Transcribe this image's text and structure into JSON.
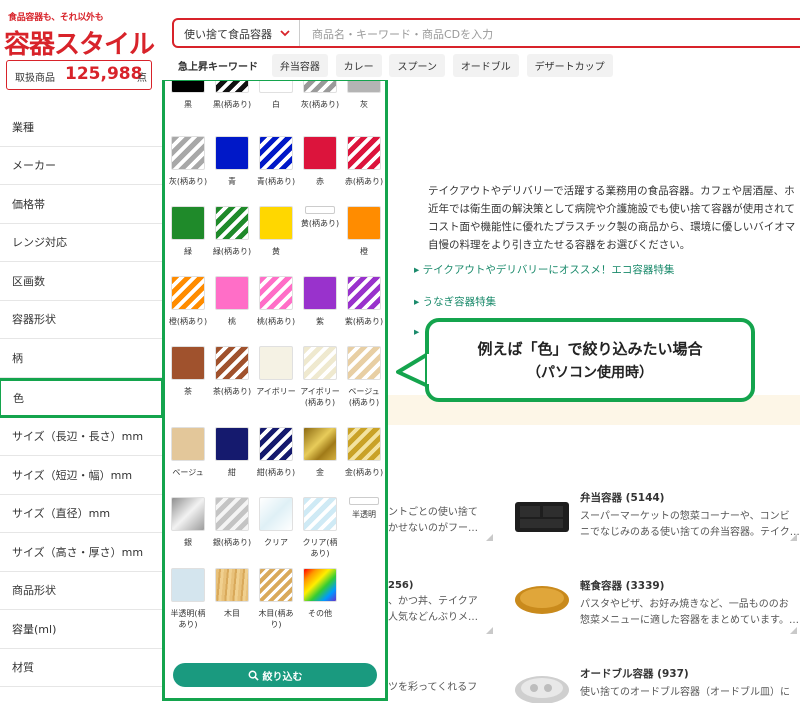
{
  "header": {
    "tagline": "食品容器も、それ以外も",
    "logo_text": "容器スタイル",
    "count_label": "取扱商品",
    "count_value": "125,988",
    "count_unit": "点",
    "search_select": "使い捨て食品容器",
    "search_placeholder": "商品名・キーワード・商品CDを入力",
    "hot_title": "急上昇キーワード",
    "hot_keywords": [
      "弁当容器",
      "カレー",
      "スプーン",
      "オードブル",
      "デザートカップ"
    ]
  },
  "left_nav": {
    "items": [
      {
        "label": "業種"
      },
      {
        "label": "メーカー"
      },
      {
        "label": "価格帯"
      },
      {
        "label": "レンジ対応"
      },
      {
        "label": "区画数"
      },
      {
        "label": "容器形状"
      },
      {
        "label": "柄"
      },
      {
        "label": "色"
      },
      {
        "label": "サイズ（長辺・長さ）mm"
      },
      {
        "label": "サイズ（短辺・幅）mm"
      },
      {
        "label": "サイズ（直径）mm"
      },
      {
        "label": "サイズ（高さ・厚さ）mm"
      },
      {
        "label": "商品形状"
      },
      {
        "label": "容量(ml)"
      },
      {
        "label": "材質"
      }
    ]
  },
  "color_panel": {
    "swatches": [
      {
        "label": "黒",
        "color": "#000000",
        "style": "solid"
      },
      {
        "label": "黒(柄あり)",
        "color": "#111111",
        "style": "stripe"
      },
      {
        "label": "白",
        "color": "#ffffff",
        "style": "solid"
      },
      {
        "label": "灰(柄あり)",
        "color": "#9a9a9a",
        "style": "stripe"
      },
      {
        "label": "灰",
        "color": "#b4b4b4",
        "style": "solid"
      },
      {
        "label": "灰(柄あり)",
        "color": "#a8a8a8",
        "style": "stripe"
      },
      {
        "label": "青",
        "color": "#0018c8",
        "style": "solid"
      },
      {
        "label": "青(柄あり)",
        "color": "#0018c8",
        "style": "stripe"
      },
      {
        "label": "赤",
        "color": "#dc143c",
        "style": "solid"
      },
      {
        "label": "赤(柄あり)",
        "color": "#dc143c",
        "style": "stripe"
      },
      {
        "label": "緑",
        "color": "#1f8a2a",
        "style": "solid"
      },
      {
        "label": "緑(柄あり)",
        "color": "#1f8a2a",
        "style": "stripe"
      },
      {
        "label": "黄",
        "color": "#ffd700",
        "style": "solid"
      },
      {
        "label": "黄(柄あり)",
        "color": "#ffffff",
        "style": "small"
      },
      {
        "label": "橙",
        "color": "#ff8c00",
        "style": "solid"
      },
      {
        "label": "橙(柄あり)",
        "color": "#ff8c00",
        "style": "stripe"
      },
      {
        "label": "桃",
        "color": "#ff6ec7",
        "style": "solid"
      },
      {
        "label": "桃(柄あり)",
        "color": "#ff6ec7",
        "style": "stripe"
      },
      {
        "label": "紫",
        "color": "#9932cc",
        "style": "solid"
      },
      {
        "label": "紫(柄あり)",
        "color": "#9932cc",
        "style": "stripe"
      },
      {
        "label": "茶",
        "color": "#a0522d",
        "style": "solid"
      },
      {
        "label": "茶(柄あり)",
        "color": "#a0522d",
        "style": "stripe"
      },
      {
        "label": "アイボリー",
        "color": "#f5f2e4",
        "style": "solid"
      },
      {
        "label": "アイボリー(柄あり)",
        "color": "#efe9cf",
        "style": "stripe"
      },
      {
        "label": "ベージュ(柄あり)",
        "color": "#e8cfa4",
        "style": "stripe"
      },
      {
        "label": "ベージュ",
        "color": "#e3c79a",
        "style": "solid"
      },
      {
        "label": "紺",
        "color": "#151a6e",
        "style": "solid"
      },
      {
        "label": "紺(柄あり)",
        "color": "#151a6e",
        "style": "stripe"
      },
      {
        "label": "金",
        "color": "#c9a227",
        "style": "gold"
      },
      {
        "label": "金(柄あり)",
        "color": "#c9a227",
        "style": "goldstripe"
      },
      {
        "label": "銀",
        "color": "#b8b8b8",
        "style": "silver"
      },
      {
        "label": "銀(柄あり)",
        "color": "#c4c4c4",
        "style": "silverstripe"
      },
      {
        "label": "クリア",
        "color": "#eaf4f8",
        "style": "clear"
      },
      {
        "label": "クリア(柄あり)",
        "color": "#cfeaf5",
        "style": "clearstripe"
      },
      {
        "label": "半透明",
        "color": "#ffffff",
        "style": "small"
      },
      {
        "label": "半透明(柄あり)",
        "color": "#d4e5ee",
        "style": "solid"
      },
      {
        "label": "木目",
        "color": "#e8c17a",
        "style": "wood"
      },
      {
        "label": "木目(柄あり)",
        "color": "#e8c17a",
        "style": "woodstripe"
      },
      {
        "label": "その他",
        "color": "#ff0000",
        "style": "rainbow"
      }
    ],
    "filter_label": "絞り込む"
  },
  "main": {
    "description": [
      "テイクアウトやデリバリーで活躍する業務用の食品容器。カフェや居酒屋、ホ",
      "近年では衛生面の解決策として病院や介護施設でも使い捨て容器が使用されて",
      "コスト面や機能性に優れたプラスチック製の商品から、環境に優しいバイオマ",
      "自慢の料理をより引き立たせる容器をお選びください。"
    ],
    "links": [
      "テイクアウトやデリバリーにオススメ！エコ容器特集",
      "うなぎ容器特集"
    ],
    "snippets": [
      {
        "line1": "ントごとの使い捨て",
        "line2": "かせないのがフー…"
      },
      {
        "line1": "256)",
        "line2": "、かつ丼、テイクア",
        "line3": "人気などんぶりメ…"
      },
      {
        "line1": "ツを彩ってくれるフ"
      }
    ],
    "categories": [
      {
        "title": "弁当容器 (5144)",
        "desc1": "スーパーマーケットの惣菜コーナーや、コンビ",
        "desc2": "ニでなじみのある使い捨ての弁当容器。テイク…"
      },
      {
        "title": "軽食容器 (3339)",
        "desc1": "パスタやピザ、お好み焼きなど、一品もののお",
        "desc2": "惣菜メニューに適した容器をまとめています。…"
      },
      {
        "title": "オードブル容器 (937)",
        "desc1": "使い捨てのオードブル容器（オードブル皿）に",
        "desc2": "は"
      }
    ]
  },
  "callout": {
    "line1": "例えば「色」で絞り込みたい場合",
    "line2": "（パソコン使用時）"
  },
  "colors": {
    "brand_red": "#d8232a",
    "highlight_green": "#14a44d",
    "button_teal": "#1a9a7f",
    "link_teal": "#1a8a6b"
  }
}
